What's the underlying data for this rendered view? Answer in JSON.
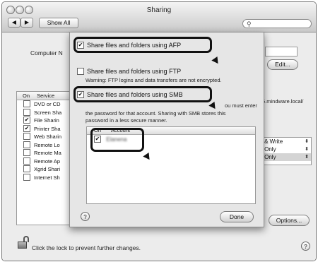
{
  "window": {
    "title": "Sharing"
  },
  "toolbar": {
    "back": "◀",
    "forward": "▶",
    "show_all": "Show All",
    "search_placeholder": ""
  },
  "background": {
    "computer_name_label": "Computer N",
    "edit_button": "Edit...",
    "address_fragment": "5.mindware.local/",
    "services": {
      "col_on": "On",
      "col_service": "Service",
      "items": [
        {
          "label": "DVD or CD",
          "checked": false
        },
        {
          "label": "Screen Sha",
          "checked": false
        },
        {
          "label": "File Sharin",
          "checked": true
        },
        {
          "label": "Printer Sha",
          "checked": true
        },
        {
          "label": "Web Sharin",
          "checked": false
        },
        {
          "label": "Remote Lo",
          "checked": false
        },
        {
          "label": "Remote Ma",
          "checked": false
        },
        {
          "label": "Remote Ap",
          "checked": false
        },
        {
          "label": "Xgrid Shari",
          "checked": false
        },
        {
          "label": "Internet Sh",
          "checked": false
        }
      ]
    },
    "permissions": [
      "ad & Write",
      "ad Only",
      "ad Only"
    ],
    "options_button": "Options...",
    "lock_text": "Click the lock to prevent further changes.",
    "help": "?"
  },
  "sheet": {
    "afp_label": "Share files and folders using AFP",
    "afp_checked": true,
    "ftp_label": "Share files and folders using FTP",
    "ftp_checked": false,
    "ftp_warning": "Warning: FTP logins and data transfers are not encrypted.",
    "smb_label": "Share files and folders using SMB",
    "smb_checked": true,
    "smb_desc_right": "ou must enter",
    "smb_desc_line2": "the password for that account. Sharing with SMB stores this",
    "smb_desc_line3": "password in a less secure manner.",
    "accounts": {
      "col_on": "On",
      "col_account": "Account",
      "rows": [
        {
          "name": "Elanena",
          "checked": true
        }
      ]
    },
    "help": "?",
    "done_button": "Done"
  },
  "colors": {
    "highlight": "#111111",
    "sheet_bg": "#e6e6e6"
  }
}
